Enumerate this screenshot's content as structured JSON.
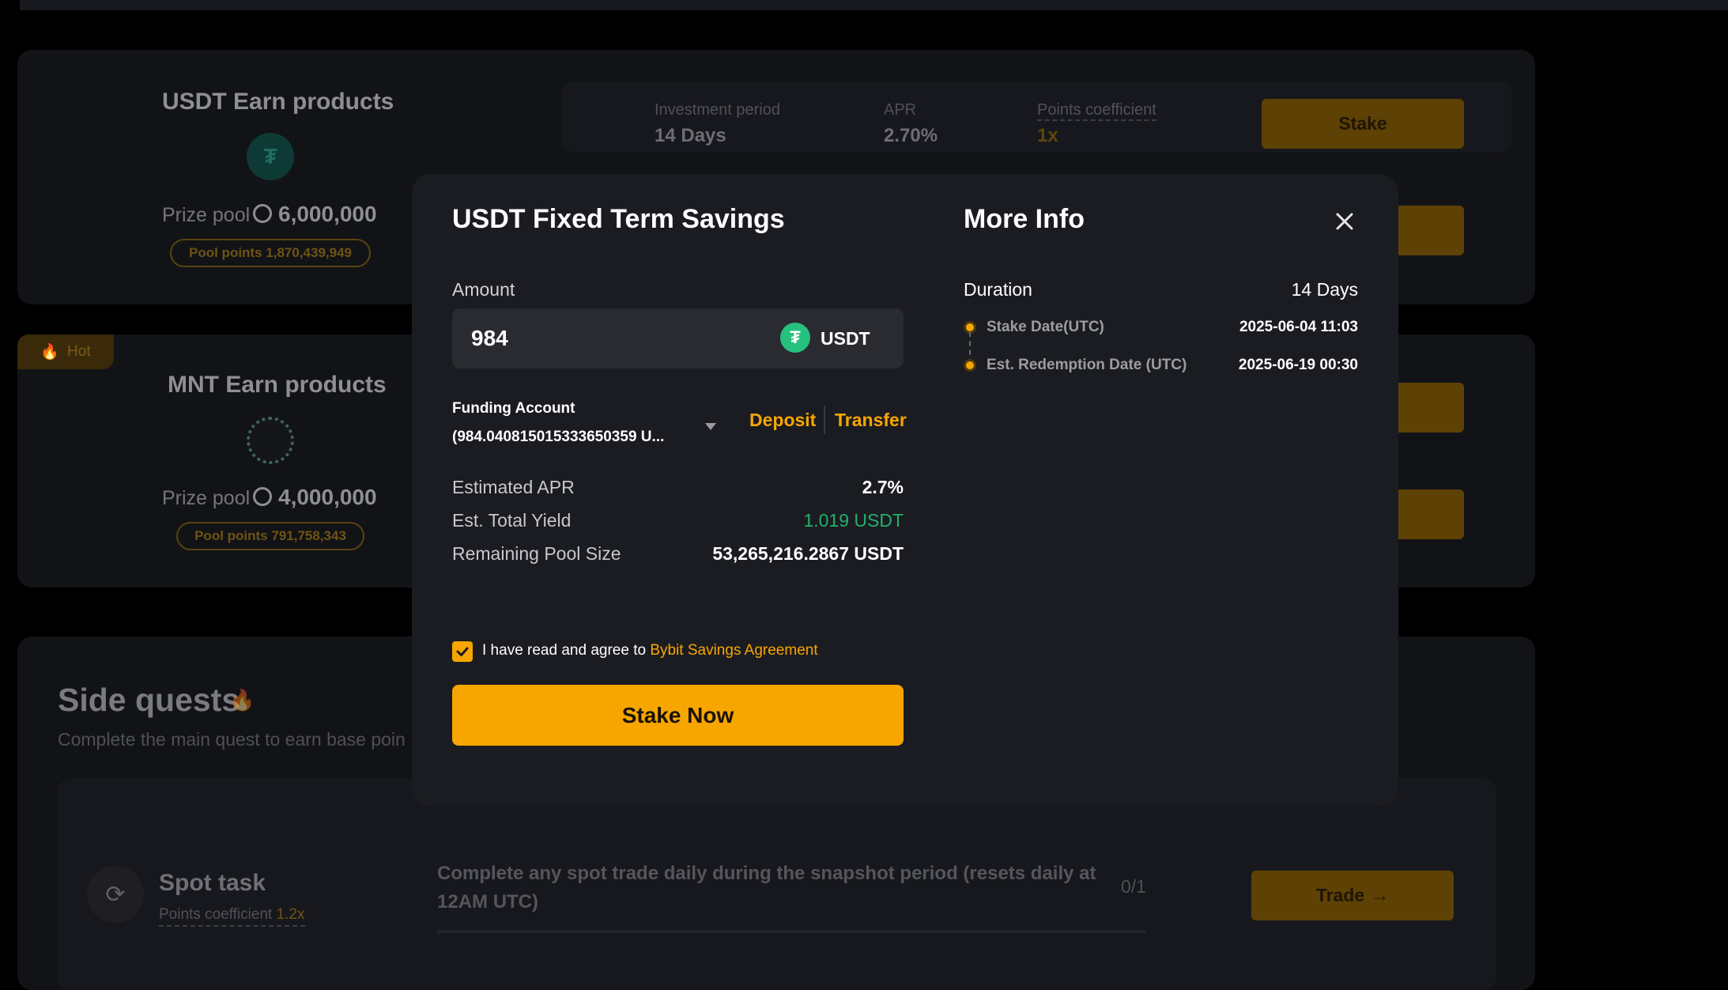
{
  "background": {
    "usdt_card": {
      "title": "USDT Earn products",
      "coin_symbol": "₮",
      "prize_pool_label": "Prize pool",
      "prize_pool_value": "6,000,000",
      "pool_points": "Pool points 1,870,439,949",
      "product": {
        "period_label": "Investment period",
        "period_value": "14 Days",
        "apr_label": "APR",
        "apr_value": "2.70%",
        "coef_label": "Points coefficient",
        "coef_value": "1x",
        "stake_label": "Stake"
      }
    },
    "mnt_card": {
      "hot_label": "Hot",
      "title": "MNT Earn products",
      "prize_pool_label": "Prize pool",
      "prize_pool_value": "4,000,000",
      "pool_points": "Pool points 791,758,343"
    },
    "side_quests": {
      "title": "Side quests",
      "subtitle": "Complete the main quest to earn base poin",
      "task": {
        "name": "Spot task",
        "coef_label": "Points coefficient",
        "coef_value": "1.2x",
        "description": "Complete any spot trade daily during the snapshot period (resets daily at 12AM UTC)",
        "progress": "0/1",
        "button_label": "Trade"
      }
    }
  },
  "modal": {
    "title": "USDT Fixed Term Savings",
    "amount_label": "Amount",
    "amount_value": "984",
    "currency": "USDT",
    "currency_symbol": "₮",
    "funding_account_label": "Funding Account",
    "funding_account_value": "(984.040815015333650359 U...",
    "deposit_label": "Deposit",
    "transfer_label": "Transfer",
    "rows": [
      {
        "label": "Estimated APR",
        "value": "2.7%"
      },
      {
        "label": "Est. Total Yield",
        "value": "1.019 USDT"
      },
      {
        "label": "Remaining Pool Size",
        "value": "53,265,216.2867 USDT"
      }
    ],
    "agreement_text": "I have read and agree to",
    "agreement_link": "Bybit Savings Agreement",
    "agreement_checked": true,
    "stake_button": "Stake Now",
    "more_info": {
      "title": "More Info",
      "duration_label": "Duration",
      "duration_value": "14 Days",
      "stake_date_label": "Stake Date(UTC)",
      "stake_date_value": "2025-06-04 11:03",
      "redemption_label": "Est. Redemption Date (UTC)",
      "redemption_value": "2025-06-19 00:30"
    }
  },
  "colors": {
    "accent": "#f7a600",
    "positive": "#20b26c",
    "usdt_green": "#26c17e",
    "modal_bg": "#1b1c21"
  }
}
